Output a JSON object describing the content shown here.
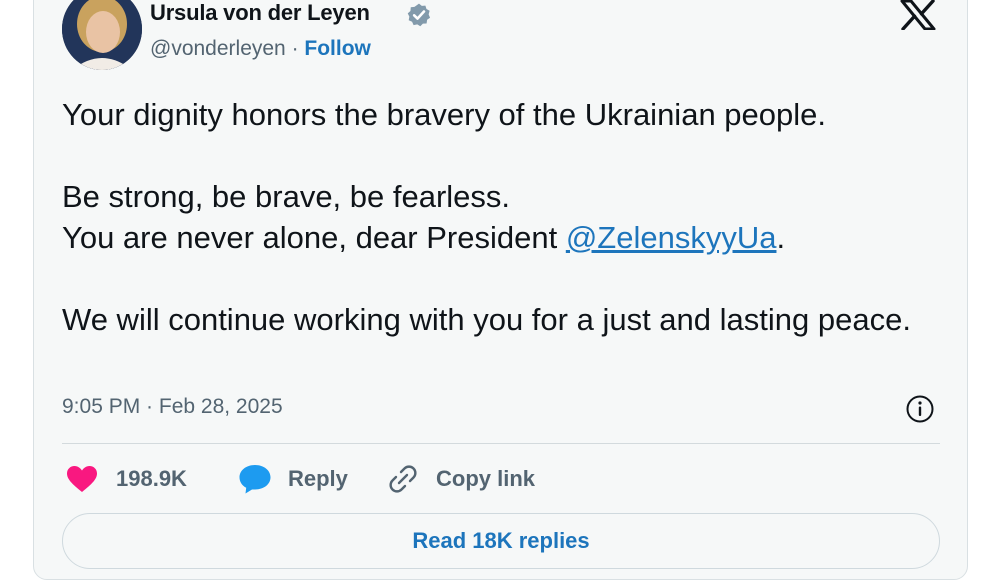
{
  "author": {
    "name": "Ursula von der Leyen",
    "handle": "@vonderleyen",
    "separator": " · ",
    "follow_label": "Follow"
  },
  "tweet": {
    "line1": "Your dignity honors the bravery of the Ukrainian people.",
    "line2": "Be strong, be brave, be fearless.",
    "line3_prefix": "You are never alone, dear President ",
    "mention": "@ZelenskyyUa",
    "line3_suffix": ".",
    "line4": "We will continue working with you for a just and lasting peace.",
    "timestamp": "9:05 PM · Feb 28, 2025"
  },
  "actions": {
    "likes": "198.9K",
    "reply_label": "Reply",
    "copy_label": "Copy link"
  },
  "replies_button": "Read 18K replies",
  "colors": {
    "accent": "#1d75bc",
    "like": "#f91880",
    "reply_icon": "#1d9bf0",
    "verified": "#829aab"
  },
  "icons": {
    "verified": "verified-badge-icon",
    "logo": "x-logo-icon",
    "info": "info-icon",
    "like": "heart-icon",
    "reply": "speech-bubble-icon",
    "copy": "link-icon"
  }
}
